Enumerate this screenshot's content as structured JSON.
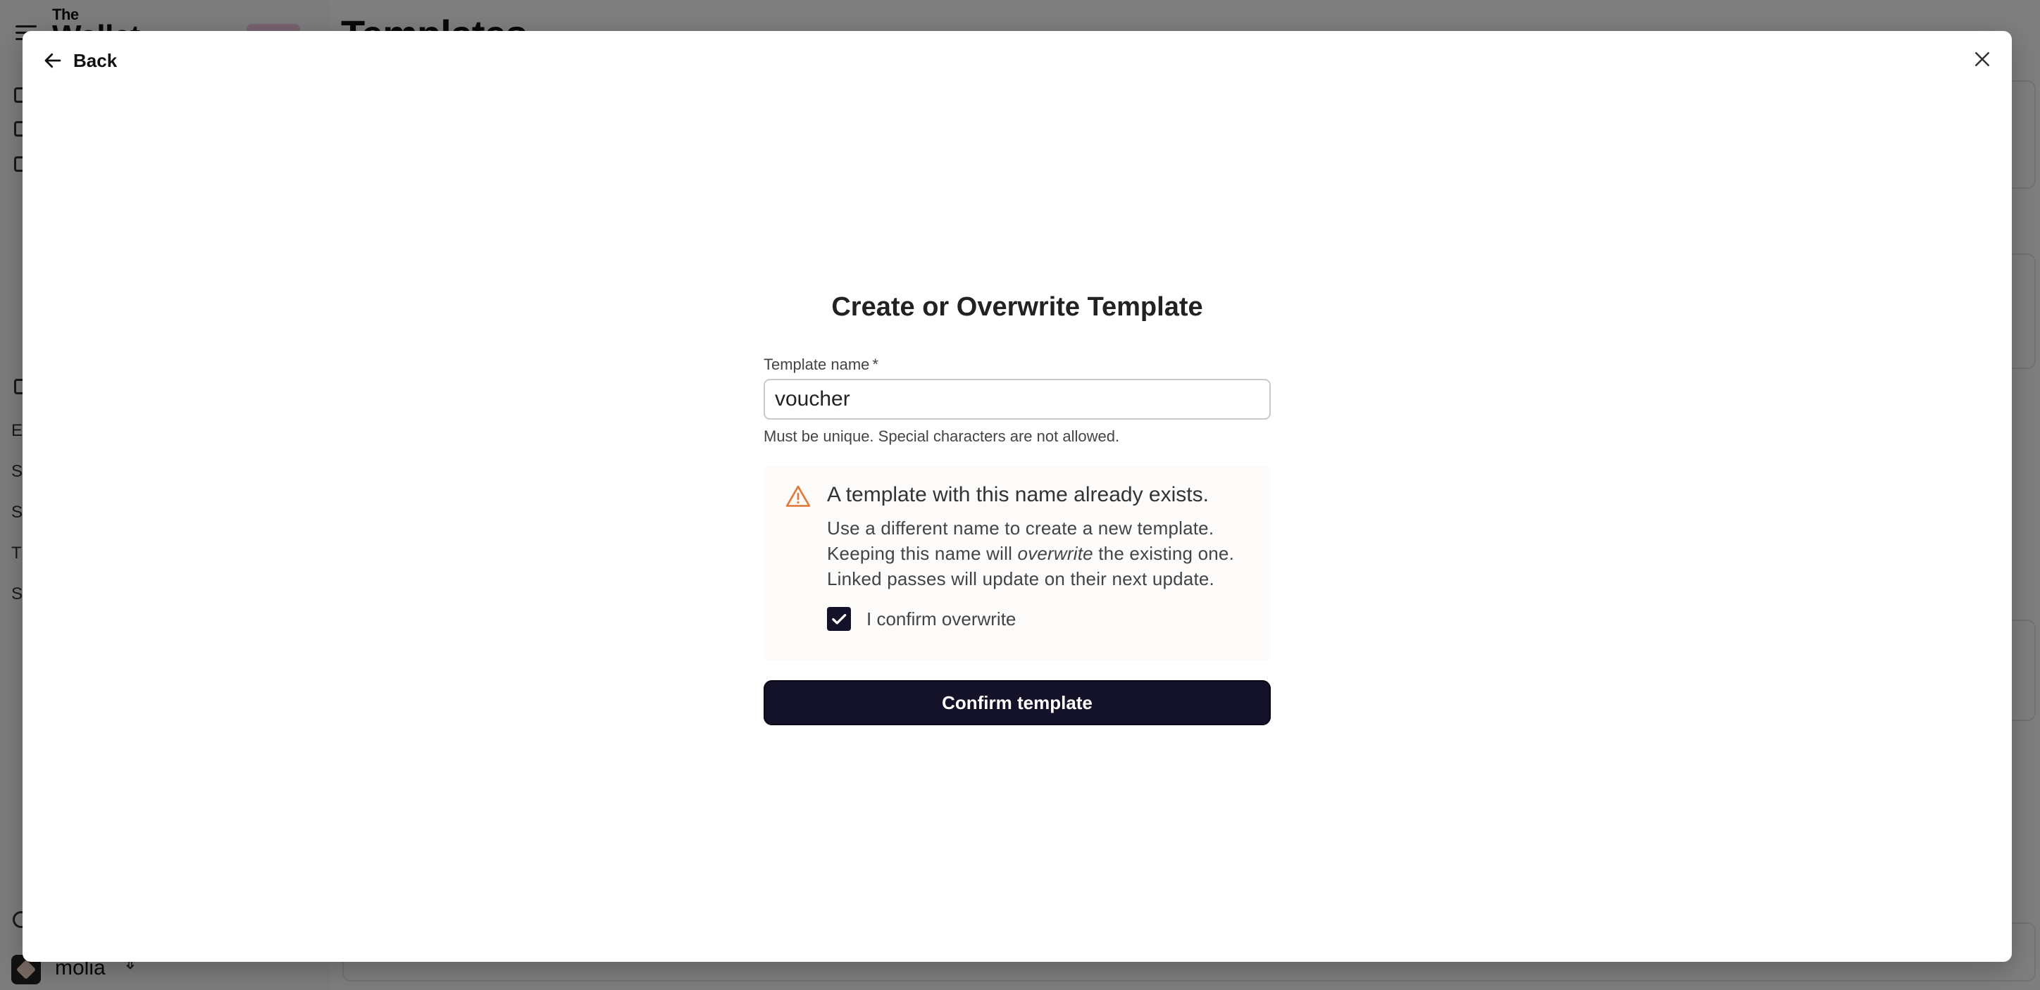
{
  "background": {
    "logo_small": "The",
    "logo_big": "Wallet",
    "page_title": "Templates",
    "nav_letters": [
      "E",
      "S",
      "S",
      "T",
      "S"
    ],
    "org_name": "molia",
    "org_chevron": "⌃⌄"
  },
  "modal": {
    "back_label": "Back",
    "close_icon": "close-icon",
    "title": "Create or Overwrite Template",
    "template_name": {
      "label": "Template name",
      "required_mark": "*",
      "value": "voucher",
      "helper": "Must be unique. Special characters are not allowed."
    },
    "warning": {
      "icon": "warning-triangle-icon",
      "color": "#e07a3a",
      "title": "A template with this name already exists.",
      "line1": "Use a different name to create a new template.",
      "line2_before": "Keeping this name will ",
      "line2_emphasis": "overwrite",
      "line2_after": " the existing one.",
      "line3": "Linked passes will update on their next update.",
      "confirm_label": "I confirm overwrite",
      "confirm_checked": true
    },
    "submit_label": "Confirm template"
  },
  "colors": {
    "primary": "#141228",
    "warning": "#e07a3a"
  }
}
